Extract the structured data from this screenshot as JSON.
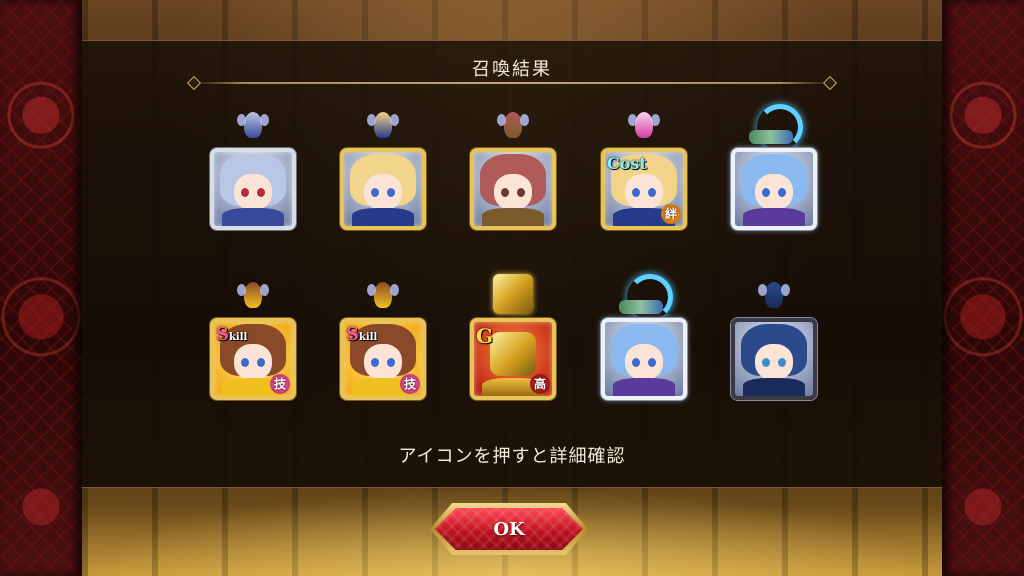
{
  "panel": {
    "title": "召喚結果",
    "hint": "アイコンを押すと詳細確認"
  },
  "ok_button": {
    "label": "OK"
  },
  "units": [
    {
      "id": "unit-1",
      "frame": "silver",
      "hair": "#b9c6e6",
      "eye": "#b0303a",
      "outfit": "#3a4a9a",
      "sprite": "fairy",
      "badge": null,
      "kanji": null
    },
    {
      "id": "unit-2",
      "frame": "gold",
      "hair": "#f2d48a",
      "eye": "#3a6ad0",
      "outfit": "#2a3a8a",
      "sprite": "fairy",
      "badge": null,
      "kanji": null
    },
    {
      "id": "unit-3",
      "frame": "gold",
      "hair": "#b05a5a",
      "eye": "#6a3a2a",
      "outfit": "#7a5a2a",
      "sprite": "fairy",
      "badge": null,
      "kanji": null
    },
    {
      "id": "unit-4",
      "frame": "gold",
      "hair": "#f2d48a",
      "eye": "#3a6ad0",
      "outfit": "#2a3a8a",
      "sprite": "fairy-pink",
      "badge": "Cost",
      "kanji": "絆"
    },
    {
      "id": "unit-5",
      "frame": "platinum",
      "hair": "#8ab8f0",
      "eye": "#3a6ad0",
      "outfit": "#5a3a9a",
      "sprite": "dragon",
      "badge": null,
      "kanji": null
    },
    {
      "id": "unit-6",
      "frame": "gold",
      "hair": "#8a4a2a",
      "eye": "#3a6ad0",
      "outfit": "#f0c020",
      "sprite": "fairy",
      "badge": "Skill",
      "kanji": "技"
    },
    {
      "id": "unit-7",
      "frame": "gold",
      "hair": "#8a4a2a",
      "eye": "#3a6ad0",
      "outfit": "#f0c020",
      "sprite": "fairy",
      "badge": "Skill",
      "kanji": "技"
    },
    {
      "id": "unit-8",
      "frame": "gold",
      "hair": "#e0b030",
      "eye": "#e0b030",
      "outfit": "#d09010",
      "sprite": "gold",
      "badge": "G",
      "kanji": "高"
    },
    {
      "id": "unit-9",
      "frame": "platinum",
      "hair": "#8ab8f0",
      "eye": "#3a6ad0",
      "outfit": "#5a3a9a",
      "sprite": "dragon",
      "badge": null,
      "kanji": null
    },
    {
      "id": "unit-10",
      "frame": "black",
      "hair": "#2a4a8a",
      "eye": "#3a8ad0",
      "outfit": "#1a2a5a",
      "sprite": "fairy",
      "badge": null,
      "kanji": null
    }
  ],
  "colors": {
    "panel_bg": "#1a1006",
    "accent_gold": "#c8a86a",
    "button_red": "#c0121f"
  }
}
